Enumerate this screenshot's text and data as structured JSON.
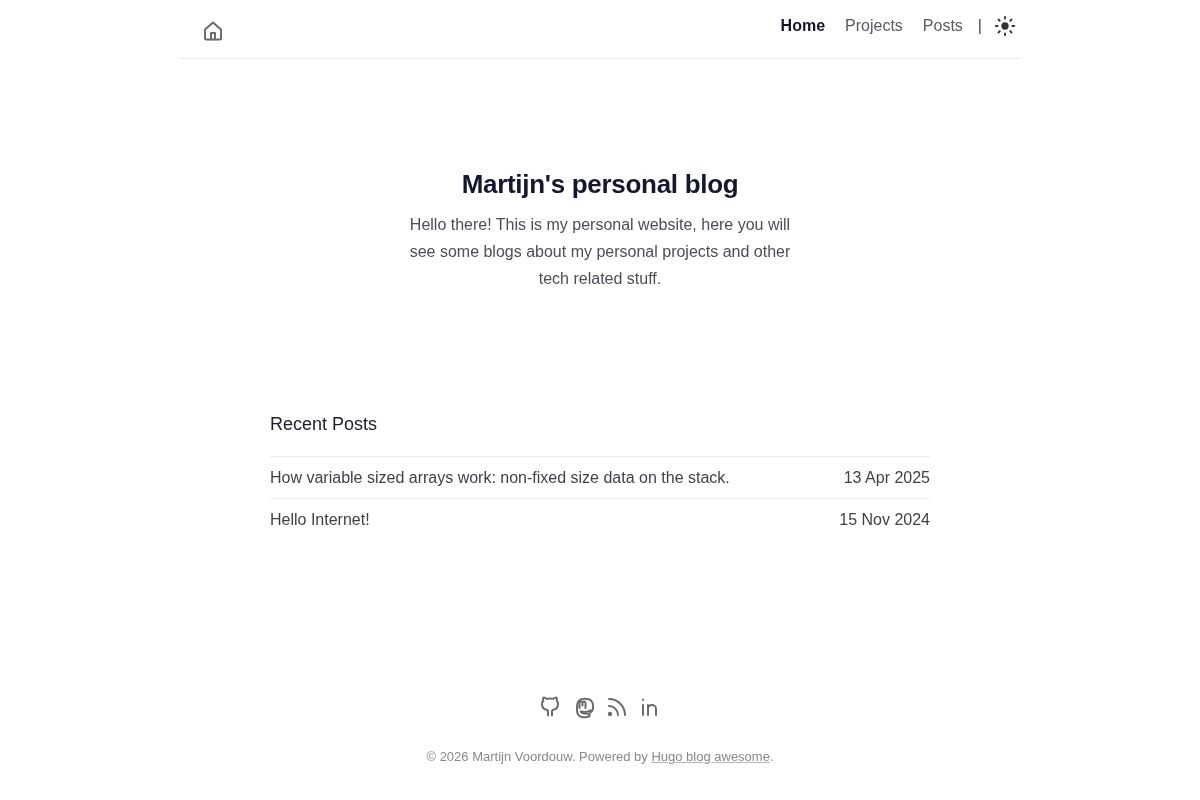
{
  "header": {
    "nav": [
      {
        "label": "Home",
        "selected": true
      },
      {
        "label": "Projects",
        "selected": false
      },
      {
        "label": "Posts",
        "selected": false
      }
    ],
    "separator": "|"
  },
  "hero": {
    "title": "Martijn's personal blog",
    "intro": "Hello there! This is my personal website, here you will see some blogs about my personal projects and other tech related stuff."
  },
  "recent_posts": {
    "heading": "Recent Posts",
    "posts": [
      {
        "title": "How variable sized arrays work: non-fixed size data on the stack.",
        "date": "13 Apr 2025"
      },
      {
        "title": "Hello Internet!",
        "date": "15 Nov 2024"
      }
    ]
  },
  "footer": {
    "social": [
      {
        "kind": "github"
      },
      {
        "kind": "mastodon"
      },
      {
        "kind": "rss"
      },
      {
        "kind": "linkedin"
      }
    ],
    "copyright": "© 2026 Martijn Voordouw. Powered by",
    "link": "Hugo blog awesome",
    "suffix": "."
  }
}
